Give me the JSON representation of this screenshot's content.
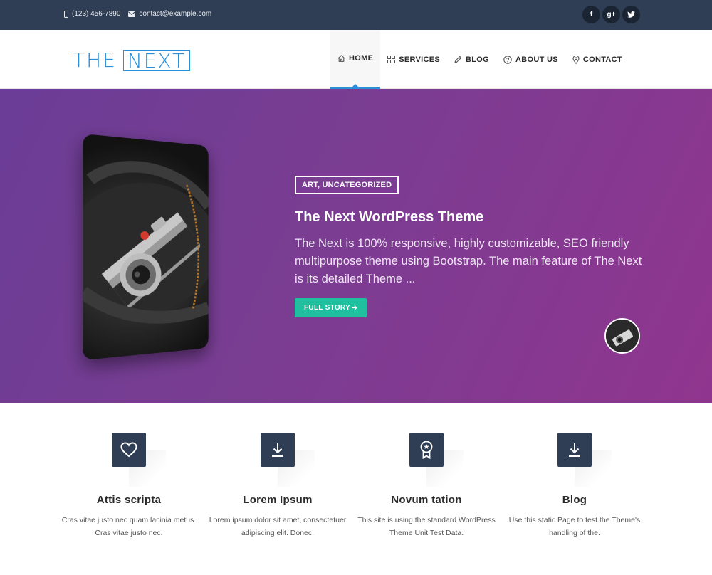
{
  "topbar": {
    "phone": "(123) 456-7890",
    "email": "contact@example.com",
    "social": [
      {
        "icon": "facebook-icon",
        "glyph": "f"
      },
      {
        "icon": "google-plus-icon",
        "glyph": "g+"
      },
      {
        "icon": "twitter-icon",
        "glyph": "t"
      }
    ]
  },
  "logo": {
    "part1": "THE",
    "part2": "NEXT",
    "color": "#2a8fd9"
  },
  "nav": {
    "items": [
      {
        "label": "HOME",
        "icon": "home-icon",
        "active": true
      },
      {
        "label": "SERVICES",
        "icon": "grid-icon"
      },
      {
        "label": "BLOG",
        "icon": "pencil-icon"
      },
      {
        "label": "ABOUT US",
        "icon": "question-icon"
      },
      {
        "label": "CONTACT",
        "icon": "map-pin-icon"
      }
    ]
  },
  "hero": {
    "category": "ART, UNCATEGORIZED",
    "title": "The Next WordPress Theme",
    "text": "The Next is 100% responsive, highly customizable, SEO friendly multipurpose theme using Bootstrap. The main feature of The Next is its detailed Theme ...",
    "button": "FULL STORY",
    "gradient": [
      "#6b3d96",
      "#90358f"
    ],
    "button_color": "#1fbfa0"
  },
  "features": [
    {
      "icon": "heart-icon",
      "title": "Attis scripta",
      "text": "Cras vitae justo nec quam lacinia metus. Cras vitae justo nec."
    },
    {
      "icon": "download-icon",
      "title": "Lorem Ipsum",
      "text": "Lorem ipsum dolor sit amet, consectetuer adipiscing elit. Donec."
    },
    {
      "icon": "award-icon",
      "title": "Novum tation",
      "text": "This site is using the standard WordPress Theme Unit Test Data."
    },
    {
      "icon": "download-icon",
      "title": "Blog",
      "text": "Use this static Page to test the Theme's handling of the."
    }
  ]
}
